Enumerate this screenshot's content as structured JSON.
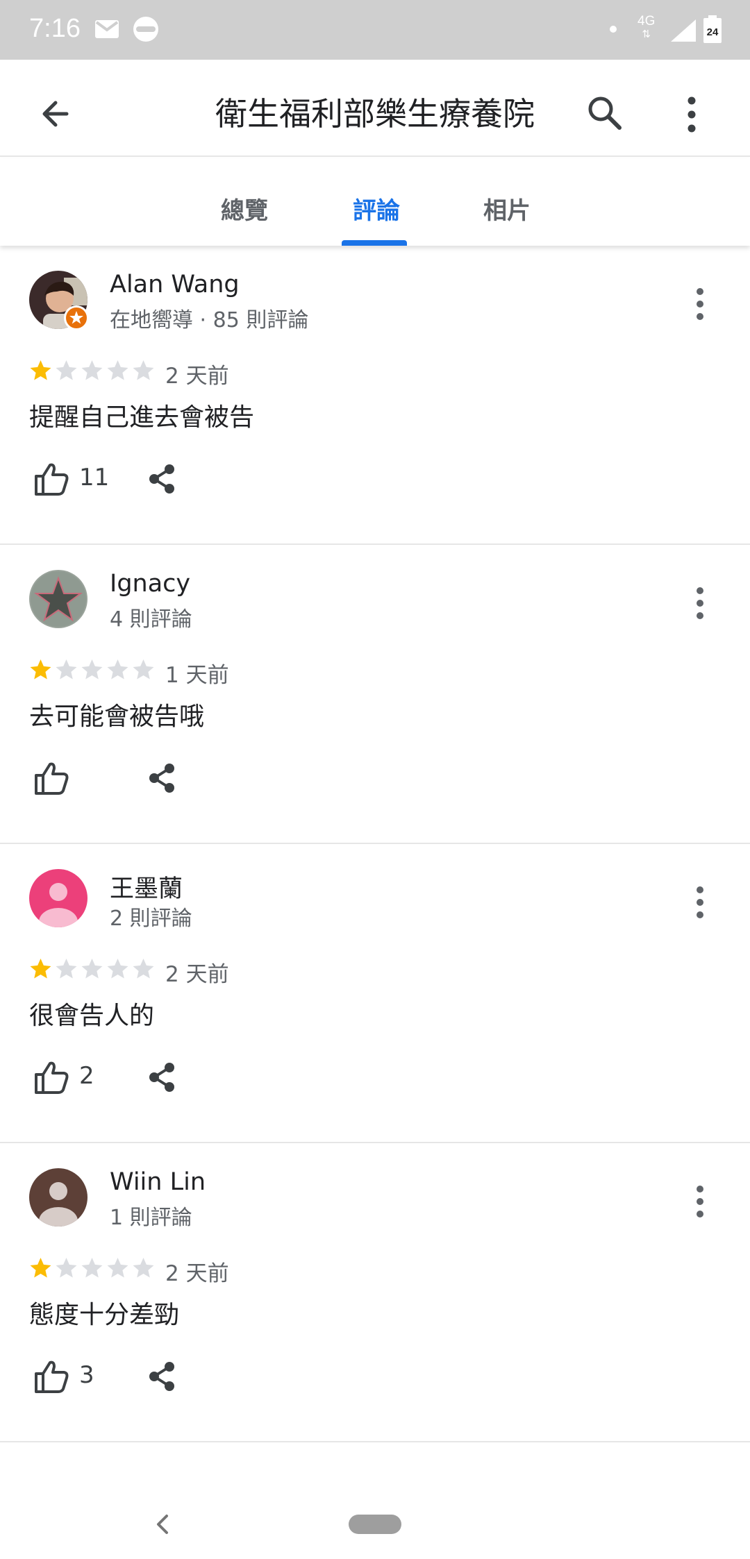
{
  "status_bar": {
    "time": "7:16",
    "network": "4G",
    "battery": "24",
    "icons": [
      "gmail-icon",
      "cloud-icon",
      "notification-dot-icon",
      "signal-icon",
      "battery-icon"
    ]
  },
  "app_bar": {
    "title": "衛生福利部樂生療養院",
    "icons": [
      "back-arrow-icon",
      "search-icon",
      "more-vert-icon"
    ]
  },
  "tabs": [
    {
      "label": "總覽",
      "active": false
    },
    {
      "label": "評論",
      "active": true
    },
    {
      "label": "相片",
      "active": false
    }
  ],
  "colors": {
    "accent": "#1a73e8",
    "star_filled": "#fbbc04",
    "star_empty": "#dadce0",
    "status_bar": "#cfcfcf"
  },
  "reviews": [
    {
      "name": "Alan Wang",
      "subtitle": "在地嚮導 · 85 則評論",
      "rating": 1,
      "max_rating": 5,
      "date": "2 天前",
      "text": "提醒自己進去會被告",
      "likes": "11",
      "avatar": "photo",
      "local_guide": true
    },
    {
      "name": "Ignacy",
      "subtitle": "4 則評論",
      "rating": 1,
      "max_rating": 5,
      "date": "1 天前",
      "text": "去可能會被告哦",
      "likes": "",
      "avatar": "star-photo",
      "local_guide": false
    },
    {
      "name": "王墨蘭",
      "subtitle": "2 則評論",
      "rating": 1,
      "max_rating": 5,
      "date": "2 天前",
      "text": "很會告人的",
      "likes": "2",
      "avatar": "pink-default",
      "local_guide": false
    },
    {
      "name": "Wiin Lin",
      "subtitle": "1 則評論",
      "rating": 1,
      "max_rating": 5,
      "date": "2 天前",
      "text": "態度十分差勁",
      "likes": "3",
      "avatar": "brown-default",
      "local_guide": false
    }
  ],
  "nav_bar": {
    "icons": [
      "nav-back-icon",
      "home-pill-icon"
    ]
  }
}
